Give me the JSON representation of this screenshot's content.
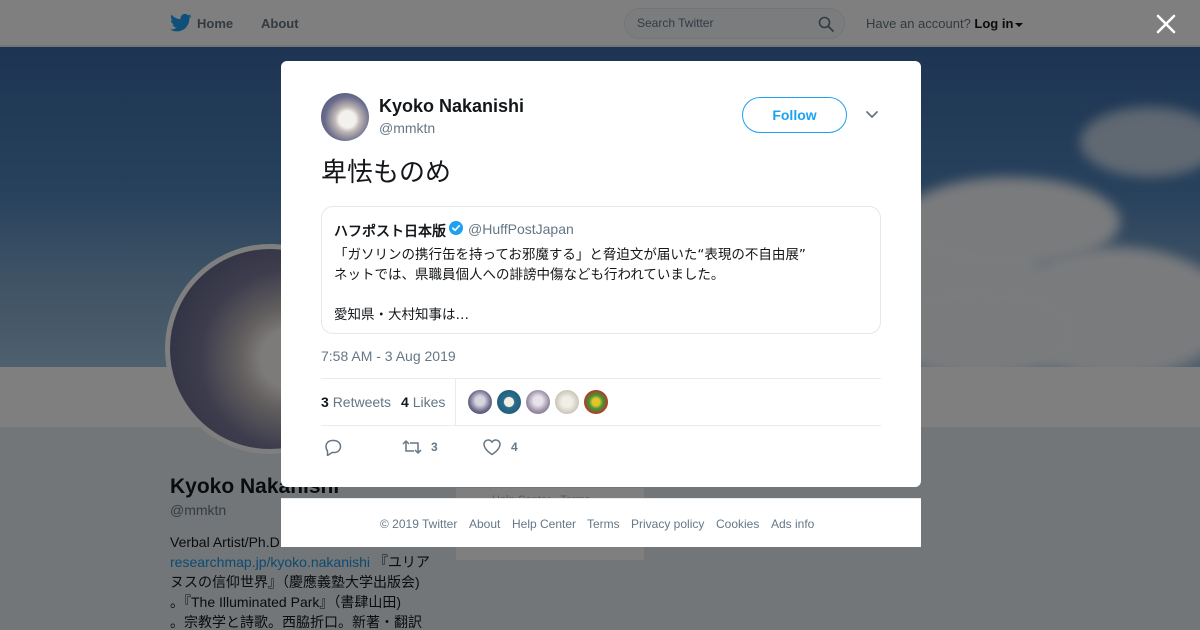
{
  "nav": {
    "home": "Home",
    "about": "About",
    "search_placeholder": "Search Twitter",
    "account_prompt": "Have an account?",
    "login": "Log in",
    "brand_color": "#1da1f2"
  },
  "profile": {
    "name": "Kyoko Nakanishi",
    "handle": "@mmktn",
    "bio_line1": "Verbal Artist/Ph.D",
    "bio_link": "researchmap.jp/kyoko.nakanishi",
    "bio_line2_tail": " 『ユリア",
    "bio_line3": "ヌスの信仰世界』（慶應義塾大学出版会)",
    "bio_line4": "。『The Illuminated Park』（書肆山田)",
    "bio_line5": "。宗教学と詩歌。西脇折口。新著・翻訳",
    "side_card_text": "Help Center · Terms"
  },
  "tweet": {
    "author_name": "Kyoko Nakanishi",
    "author_handle": "@mmktn",
    "follow_label": "Follow",
    "text": "卑怯ものめ",
    "quote": {
      "author": "ハフポスト日本版",
      "handle": "@HuffPostJapan",
      "line1": "「ガソリンの携行缶を持ってお邪魔する」と脅迫文が届いた“表現の不自由展”",
      "line2": "ネットでは、県職員個人への誹謗中傷なども行われていました。",
      "line3": "愛知県・大村知事は…"
    },
    "timestamp": "7:58 AM - 3 Aug 2019",
    "retweets_count": "3",
    "retweets_label": "Retweets",
    "likes_count": "4",
    "likes_label": "Likes",
    "action_retweet_count": "3",
    "action_like_count": "4"
  },
  "footer": {
    "copyright": "© 2019 Twitter",
    "links": [
      "About",
      "Help Center",
      "Terms",
      "Privacy policy",
      "Cookies",
      "Ads info"
    ]
  }
}
